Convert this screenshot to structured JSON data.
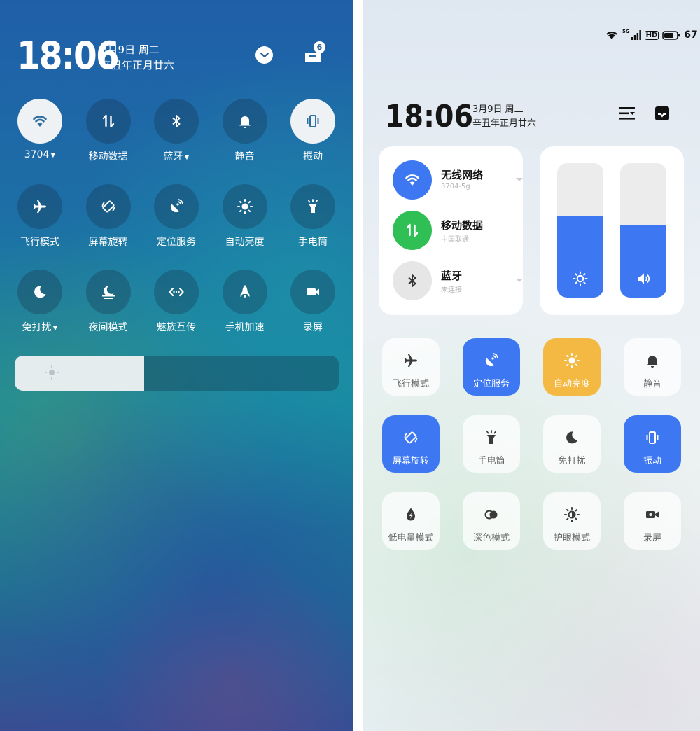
{
  "left": {
    "time": "18:06",
    "date": "3月9日 周二",
    "lunar": "辛丑年正月廿六",
    "notification_count": "6",
    "brightness_level": 0.4,
    "tiles": [
      {
        "label": "3704",
        "icon": "wifi-icon",
        "active": true,
        "caret": true
      },
      {
        "label": "移动数据",
        "icon": "mobile-data-icon",
        "active": false
      },
      {
        "label": "蓝牙",
        "icon": "bluetooth-icon",
        "active": false,
        "caret": true
      },
      {
        "label": "静音",
        "icon": "bell-icon",
        "active": false
      },
      {
        "label": "振动",
        "icon": "vibrate-icon",
        "active": true
      },
      {
        "label": "飞行模式",
        "icon": "airplane-icon",
        "active": false
      },
      {
        "label": "屏幕旋转",
        "icon": "screen-rotate-icon",
        "active": false
      },
      {
        "label": "定位服务",
        "icon": "location-icon",
        "active": false
      },
      {
        "label": "自动亮度",
        "icon": "brightness-icon",
        "active": false
      },
      {
        "label": "手电筒",
        "icon": "flashlight-icon",
        "active": false
      },
      {
        "label": "免打扰",
        "icon": "moon-icon",
        "active": false,
        "caret": true
      },
      {
        "label": "夜间模式",
        "icon": "night-mode-icon",
        "active": false
      },
      {
        "label": "魅族互传",
        "icon": "transfer-icon",
        "active": false
      },
      {
        "label": "手机加速",
        "icon": "rocket-icon",
        "active": false
      },
      {
        "label": "录屏",
        "icon": "record-screen-icon",
        "active": false
      }
    ]
  },
  "right": {
    "status": {
      "signal_tag": "5G",
      "hd": "HD",
      "battery": "67"
    },
    "time": "18:06",
    "date": "3月9日 周二",
    "lunar": "辛丑年正月廿六",
    "network": [
      {
        "title": "无线网络",
        "sub": "3704-5g",
        "icon": "wifi-icon",
        "color": "#3d78f2",
        "caret": true
      },
      {
        "title": "移动数据",
        "sub": "中国联通",
        "icon": "mobile-data-icon",
        "color": "#2fbf55",
        "caret": false
      },
      {
        "title": "蓝牙",
        "sub": "未连接",
        "icon": "bluetooth-icon",
        "color": "#e6e6e6",
        "caret": true
      }
    ],
    "brightness_level": 0.61,
    "volume_level": 0.54,
    "tiles": [
      {
        "label": "飞行模式",
        "icon": "airplane-icon",
        "state": "off"
      },
      {
        "label": "定位服务",
        "icon": "location-icon",
        "state": "blue"
      },
      {
        "label": "自动亮度",
        "icon": "brightness-icon",
        "state": "yellow"
      },
      {
        "label": "静音",
        "icon": "bell-icon",
        "state": "off"
      },
      {
        "label": "屏幕旋转",
        "icon": "screen-rotate-icon",
        "state": "blue"
      },
      {
        "label": "手电筒",
        "icon": "flashlight-icon",
        "state": "off"
      },
      {
        "label": "免打扰",
        "icon": "moon-icon",
        "state": "off"
      },
      {
        "label": "振动",
        "icon": "vibrate-icon",
        "state": "blue"
      },
      {
        "label": "低电量模式",
        "icon": "battery-saver-icon",
        "state": "off"
      },
      {
        "label": "深色模式",
        "icon": "dark-mode-icon",
        "state": "off"
      },
      {
        "label": "护眼模式",
        "icon": "eye-care-icon",
        "state": "off"
      },
      {
        "label": "录屏",
        "icon": "record-screen-icon",
        "state": "off"
      }
    ]
  }
}
